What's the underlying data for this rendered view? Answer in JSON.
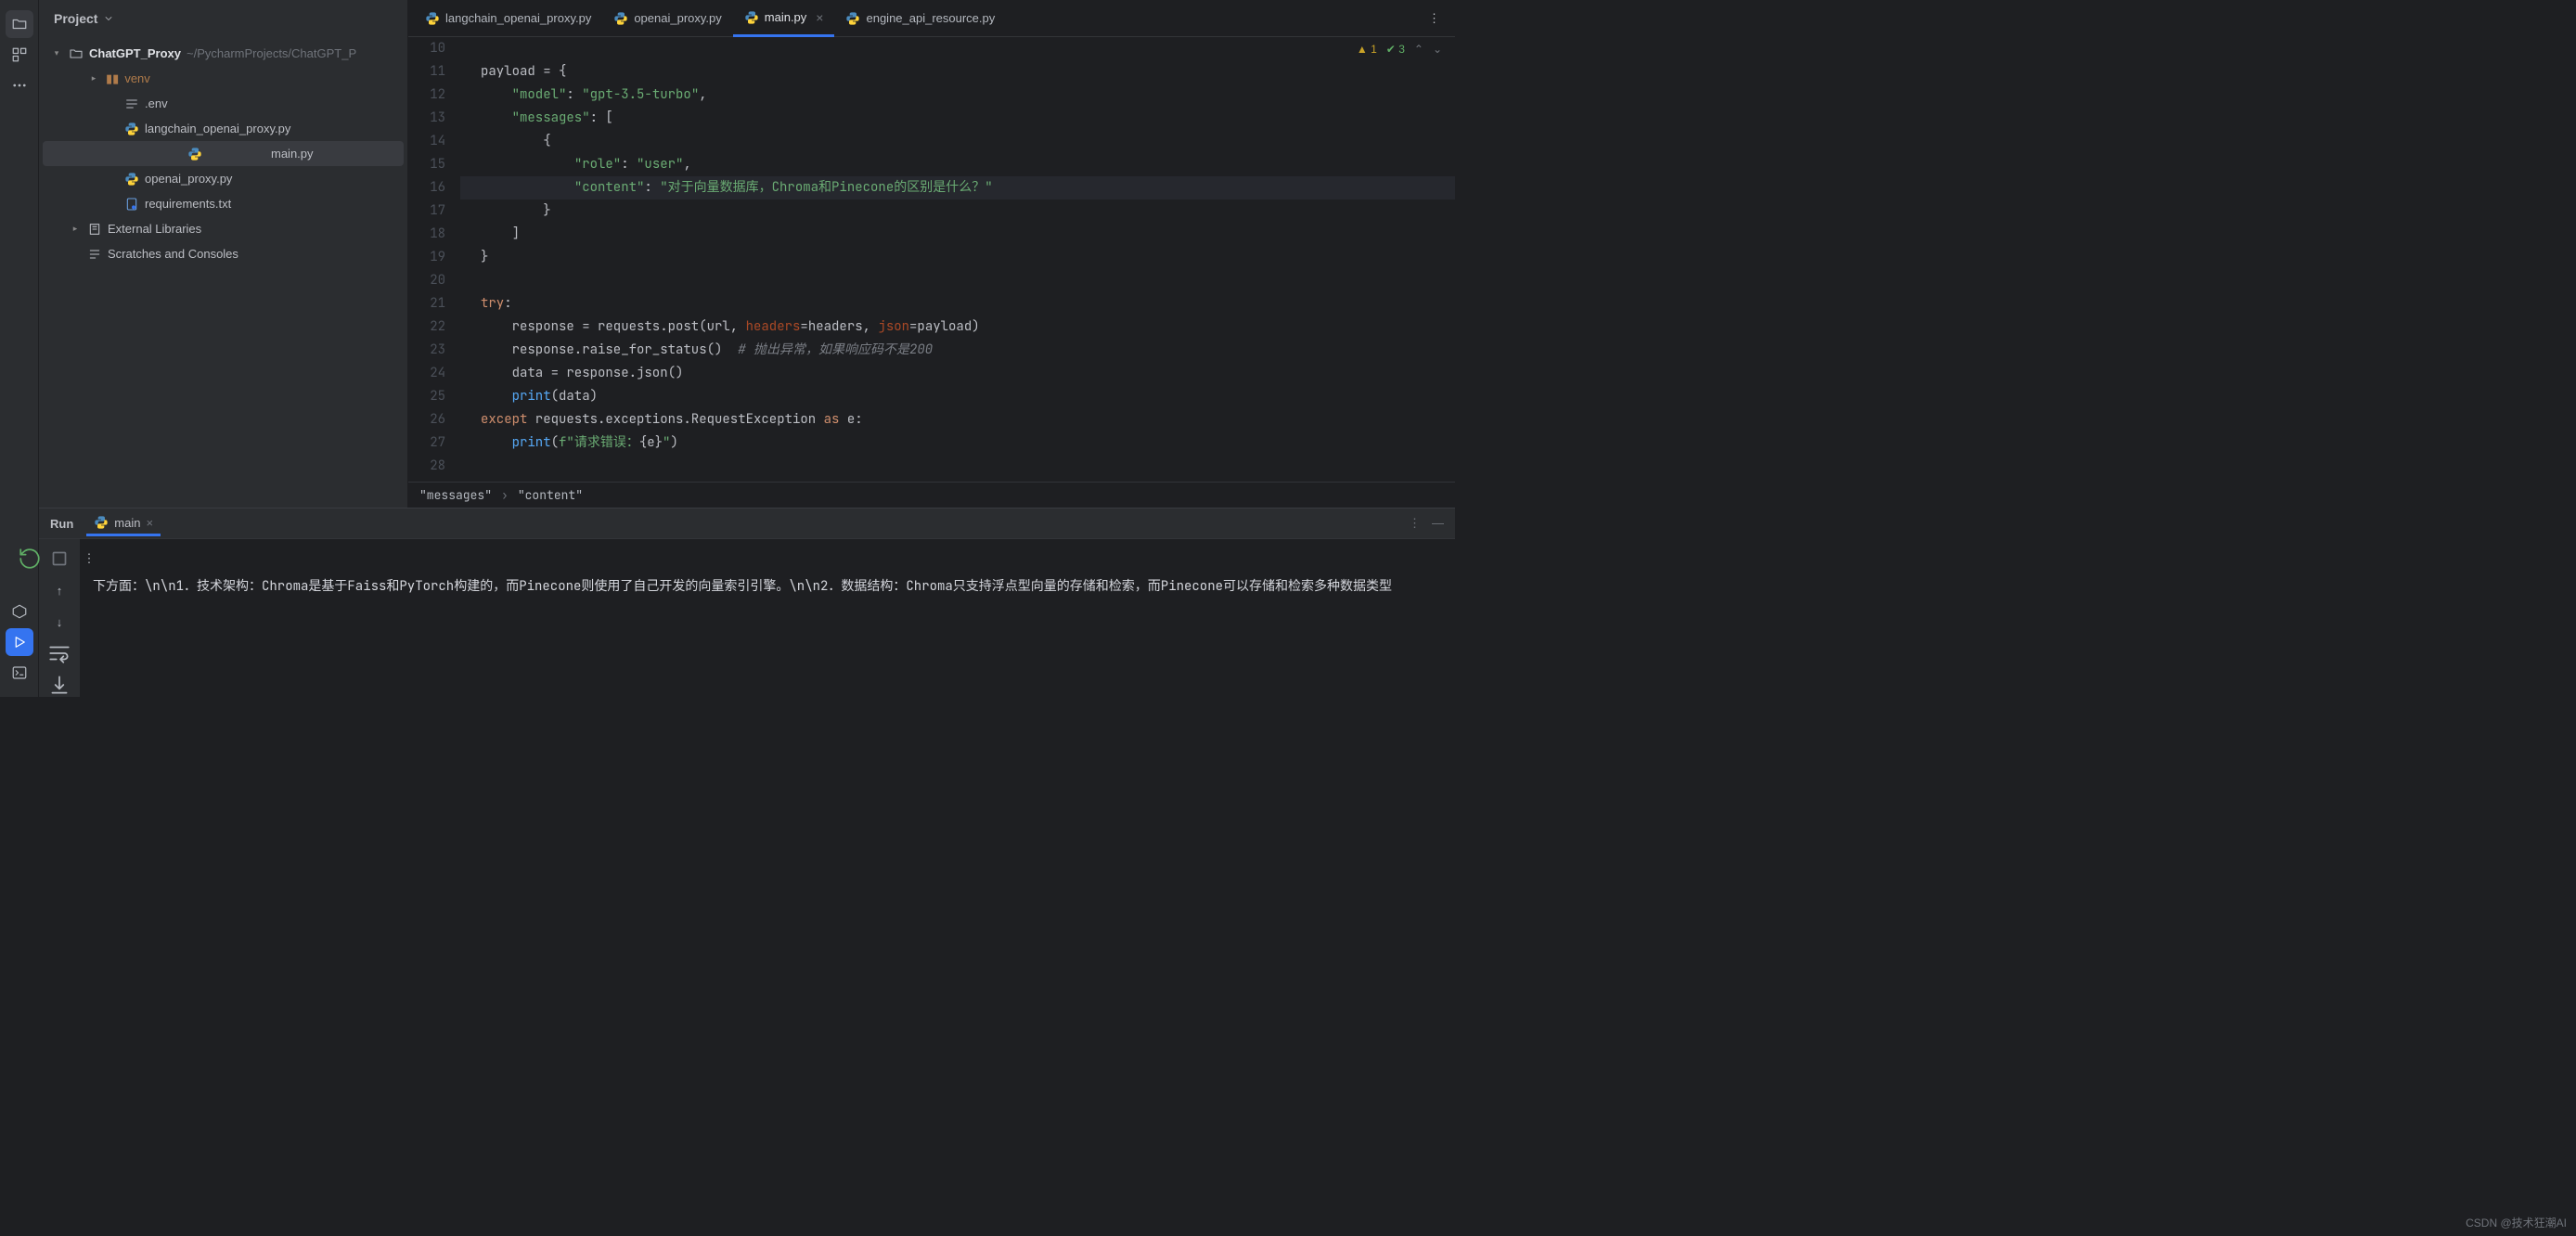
{
  "sidebar": {
    "title": "Project",
    "root": {
      "name": "ChatGPT_Proxy",
      "path": "~/PycharmProjects/ChatGPT_P"
    },
    "tree": [
      {
        "label": "venv",
        "kind": "folder-lib",
        "depth": 1,
        "chev": "right"
      },
      {
        "label": ".env",
        "kind": "env",
        "depth": 2
      },
      {
        "label": "langchain_openai_proxy.py",
        "kind": "py",
        "depth": 2
      },
      {
        "label": "main.py",
        "kind": "py",
        "depth": 2,
        "selected": true
      },
      {
        "label": "openai_proxy.py",
        "kind": "py",
        "depth": 2
      },
      {
        "label": "requirements.txt",
        "kind": "req",
        "depth": 2
      },
      {
        "label": "External Libraries",
        "kind": "ext",
        "depth": 0,
        "chev": "right"
      },
      {
        "label": "Scratches and Consoles",
        "kind": "scratch",
        "depth": 0
      }
    ]
  },
  "tabs": [
    {
      "label": "langchain_openai_proxy.py"
    },
    {
      "label": "openai_proxy.py"
    },
    {
      "label": "main.py",
      "active": true,
      "close": true
    },
    {
      "label": "engine_api_resource.py"
    }
  ],
  "inspections": {
    "warn": "1",
    "ok": "3"
  },
  "gutter_start": 10,
  "gutter_end": 28,
  "highlight_line": 16,
  "code_lines": [
    "",
    "payload = {",
    "    <s>\"model\"</s>: <s>\"gpt-3.5-turbo\"</s>,",
    "    <s>\"messages\"</s>: [",
    "        {",
    "            <s>\"role\"</s>: <s>\"user\"</s>,",
    "            <s>\"content\"</s>: <s>\"对于向量数据库，Chroma和Pinecone的区别是什么？\"</s>",
    "        }",
    "    ]",
    "}",
    "",
    "<k>try</k>:",
    "    response = requests.post(url, <a>headers</a>=headers, <a>json</a>=payload)",
    "    response.raise_for_status()  <c># 抛出异常，如果响应码不是200</c>",
    "    data = response.json()",
    "    <f>print</f>(data)",
    "<k>except</k> requests.exceptions.RequestException <k>as</k> e:",
    "    <f>print</f>(<s>f\"请求错误：</s>{e}<s>\"</s>)",
    ""
  ],
  "breadcrumbs": [
    "\"messages\"",
    "\"content\""
  ],
  "run": {
    "title": "Run",
    "config": "main",
    "output": "下方面：\\n\\n1．技术架构：Chroma是基于Faiss和PyTorch构建的，而Pinecone则使用了自己开发的向量索引引擎。\\n\\n2．数据结构：Chroma只支持浮点型向量的存储和检索，而Pinecone可以存储和检索多种数据类型"
  },
  "watermark": "CSDN @技术狂潮AI"
}
